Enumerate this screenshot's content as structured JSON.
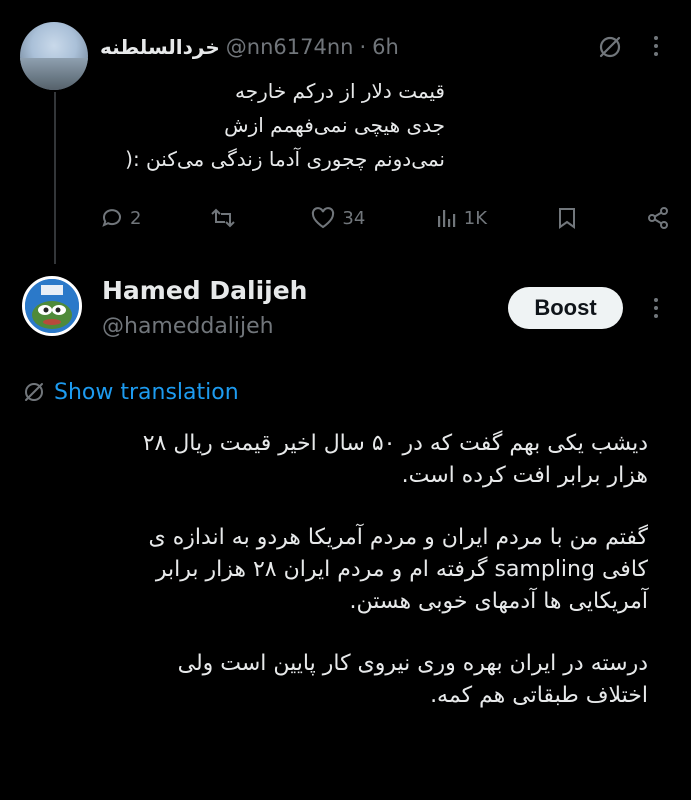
{
  "tweet1": {
    "name": "خردالسلطنه",
    "handle": "@nn6174nn",
    "separator": "·",
    "time": "6h",
    "lines": [
      "قیمت دلار از درکم خارجه",
      "جدی هیچی نمی‌فهمم ازش",
      "نمی‌دونم چجوری آدما زندگی می‌کنن :("
    ],
    "replies": "2",
    "retweets": "",
    "likes": "34",
    "views": "1K"
  },
  "tweet2": {
    "name": "Hamed Dalijeh",
    "handle": "@hameddalijeh",
    "boost_label": "Boost",
    "translate_label": "Show translation",
    "paragraphs": [
      [
        "دیشب یکی بهم گفت که در ۵۰ سال اخیر قیمت ریال ۲۸",
        "هزار برابر افت کرده است."
      ],
      [
        "گفتم من با مردم ایران و مردم آمریکا هردو به اندازه ی",
        "کافی sampling گرفته ام و مردم ایران ۲۸ هزار برابر",
        "آمریکایی ها آدمهای خوبی هستن."
      ],
      [
        "درسته در ایران بهره وری نیروی کار پایین است ولی",
        "اختلاف طبقاتی هم کمه."
      ]
    ]
  },
  "colors": {
    "background": "#000000",
    "text": "#e7e9ea",
    "muted": "#71767b",
    "link": "#1d9bf0",
    "boost_bg": "#eff3f4"
  }
}
